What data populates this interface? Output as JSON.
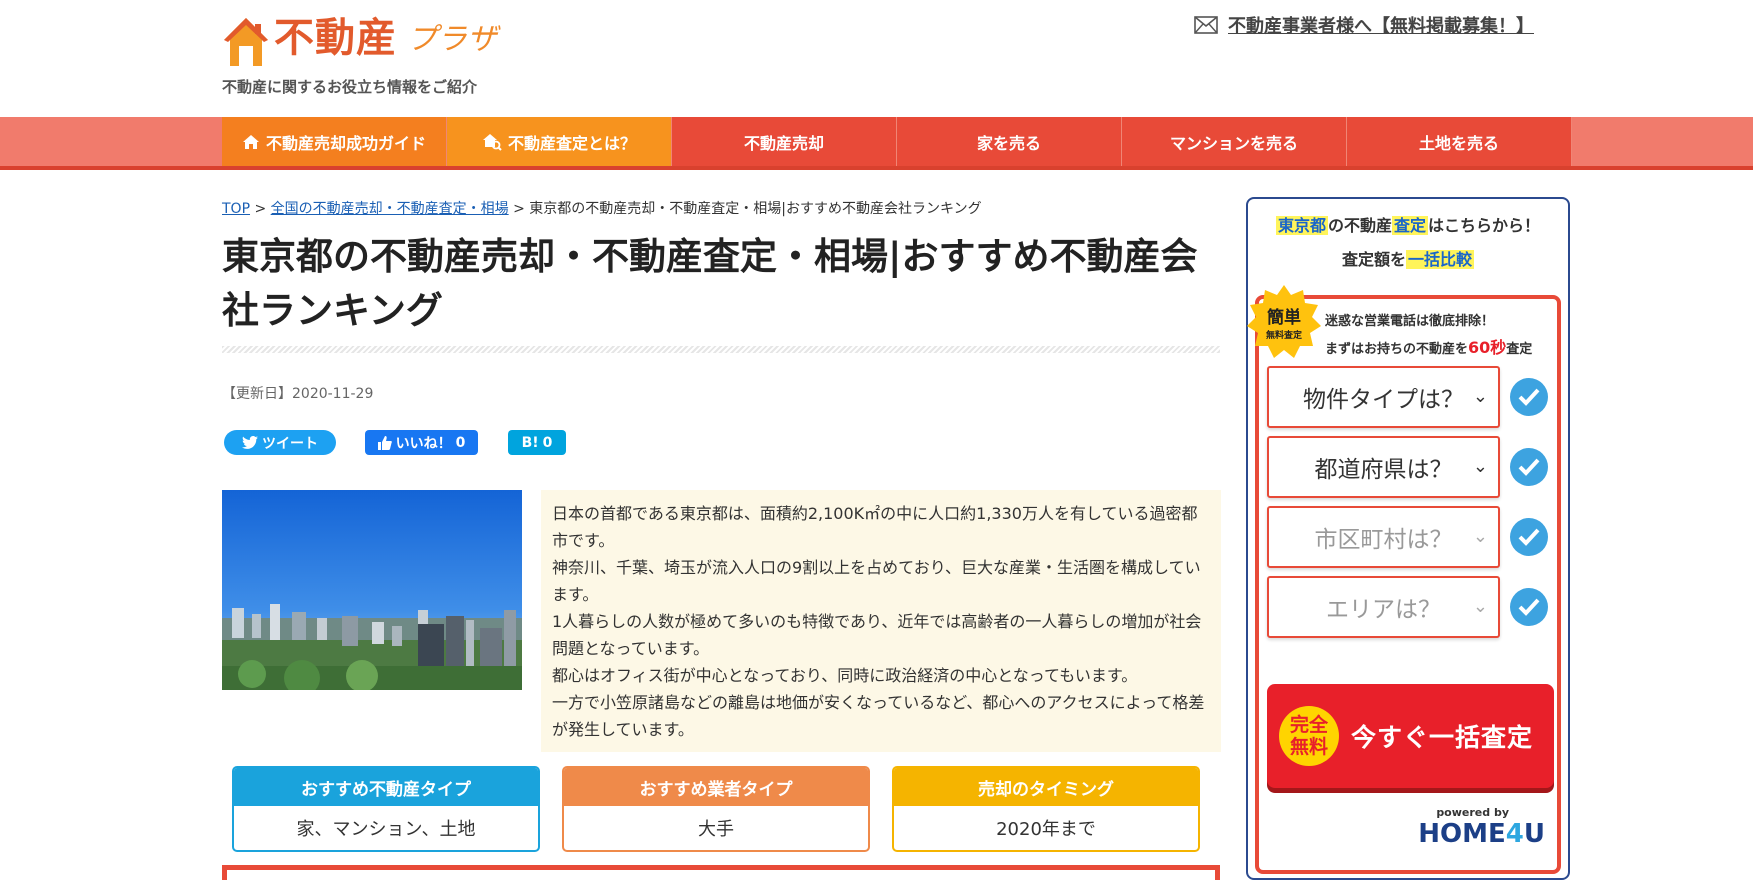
{
  "header": {
    "logo_main": "不動産",
    "logo_sub": "プラザ",
    "tagline": "不動産に関するお役立ち情報をご紹介",
    "top_link": "不動産事業者様へ【無料掲載募集！】"
  },
  "nav": {
    "items": [
      {
        "label": "不動産売却成功ガイド",
        "icon": "house-icon"
      },
      {
        "label": "不動産査定とは？",
        "icon": "house-search-icon"
      },
      {
        "label": "不動産売却"
      },
      {
        "label": "家を売る"
      },
      {
        "label": "マンションを売る"
      },
      {
        "label": "土地を売る"
      }
    ]
  },
  "breadcrumb": {
    "top": "TOP",
    "sep": ">",
    "level1": "全国の不動産売却・不動産査定・相場",
    "current": "東京都の不動産売却・不動産査定・相場|おすすめ不動産会社ランキング"
  },
  "article": {
    "title": "東京都の不動産売却・不動産査定・相場|おすすめ不動産会社ランキング",
    "updated": "【更新日】2020-11-29",
    "share": {
      "tweet": "ツイート",
      "like": "いいね！",
      "like_count": "0",
      "hatena": "B!",
      "hatena_count": "0"
    },
    "intro": [
      "日本の首都である東京都は、面積約2,100K㎡の中に人口約1,330万人を有している過密都市です。",
      "神奈川、千葉、埼玉が流入人口の9割以上を占めており、巨大な産業・生活圏を構成しています。",
      "1人暮らしの人数が極めて多いのも特徴であり、近年では高齢者の一人暮らしの増加が社会問題となっています。",
      "都心はオフィス街が中心となっており、同時に政治経済の中心となってもいます。",
      "一方で小笠原諸島などの離島は地価が安くなっているなど、都心へのアクセスによって格差が発生しています。"
    ],
    "cards": [
      {
        "head": "おすすめ不動産タイプ",
        "body": "家、マンション、土地"
      },
      {
        "head": "おすすめ業者タイプ",
        "body": "大手"
      },
      {
        "head": "売却のタイミング",
        "body": "2020年まで"
      }
    ]
  },
  "widget": {
    "head_pref": "東京都",
    "head_mid": "の不動産",
    "head_kw": "査定",
    "head_end": "はこちらから！",
    "head2_pre": "査定額を",
    "head2_kw": "一括比較",
    "seal_main": "簡単",
    "seal_sub": "無料査定",
    "note1": "迷惑な営業電話は徹底排除！",
    "note2_pre": "まずはお持ちの不動産を",
    "note2_em": "60秒",
    "note2_end": "査定",
    "selects": [
      "物件タイプは？",
      "都道府県は？",
      "市区町村は？",
      "エリアは？"
    ],
    "cta_badge1": "完全",
    "cta_badge2": "無料",
    "cta_label": "今すぐ一括査定",
    "powered_by": "powered by",
    "brand_a": "HOME",
    "brand_b": "4",
    "brand_c": "U"
  },
  "colors": {
    "brand": "#e25a2c",
    "nav": "#e84a38",
    "accent_blue": "#1aa3dc",
    "accent_orange": "#ef8a4a",
    "accent_yellow": "#f5b400"
  }
}
